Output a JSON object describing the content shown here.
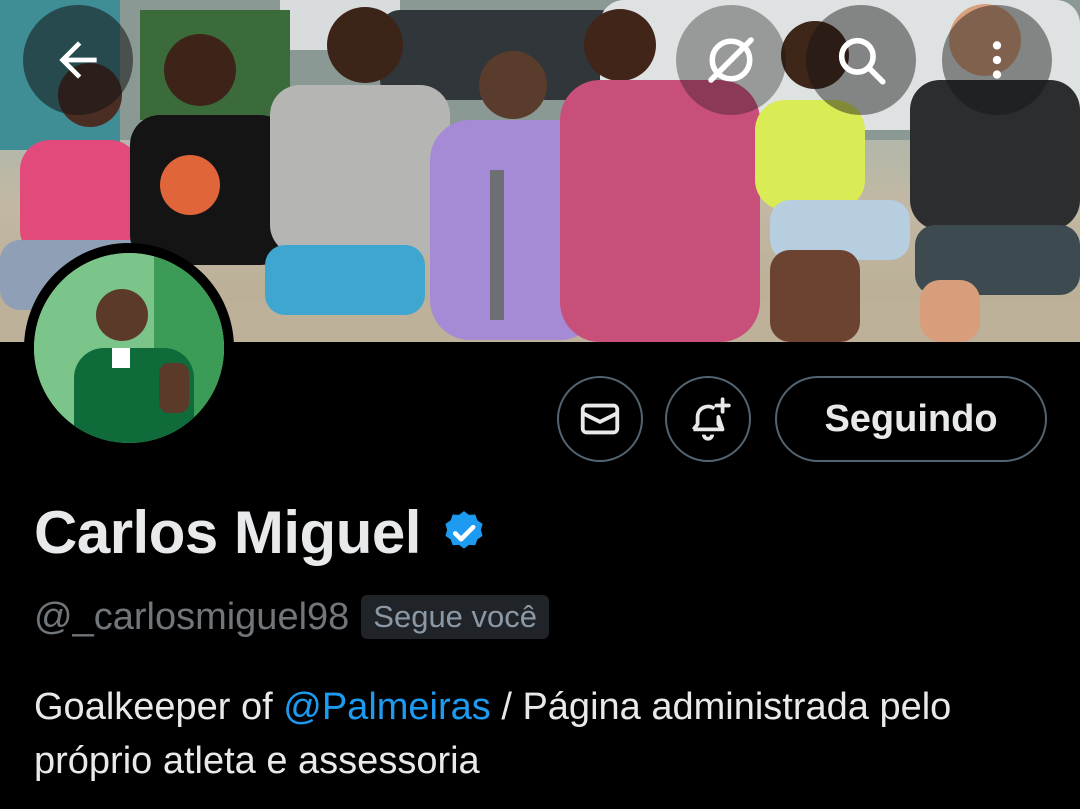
{
  "header": {
    "back_icon": "arrow-left-icon",
    "grok_icon": "slash-circle-icon",
    "search_icon": "search-icon",
    "more_icon": "more-vertical-icon"
  },
  "banner": {
    "description_icon": "banner-photo"
  },
  "actions": {
    "dm_icon": "envelope-icon",
    "notify_icon": "bell-plus-icon",
    "follow_label": "Seguindo"
  },
  "profile": {
    "display_name": "Carlos Miguel",
    "verified": true,
    "verified_color": "#1d9bf0",
    "handle": "@_carlosmiguel98",
    "follows_you": "Segue você",
    "bio_prefix": "Goalkeeper of ",
    "bio_mention": "@Palmeiras",
    "bio_suffix": " / Página administrada pelo próprio atleta e assessoria"
  },
  "colors": {
    "background": "#000000",
    "text_primary": "#e7e9ea",
    "text_secondary": "#71767b",
    "accent": "#1d9bf0",
    "border": "#536471"
  }
}
